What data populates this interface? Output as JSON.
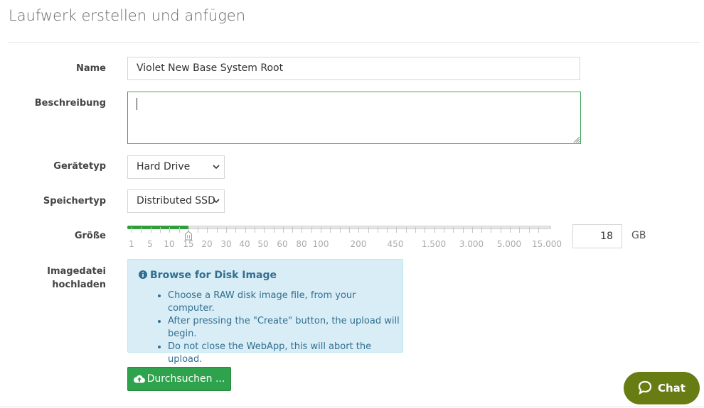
{
  "page": {
    "title": "Laufwerk erstellen und anfügen"
  },
  "form": {
    "name": {
      "label": "Name",
      "value": "Violet New Base System Root"
    },
    "description": {
      "label": "Beschreibung",
      "value": ""
    },
    "device_type": {
      "label": "Gerätetyp",
      "value": "Hard Drive"
    },
    "storage_type": {
      "label": "Speichertyp",
      "value": "Distributed SSD"
    },
    "size": {
      "label": "Größe",
      "value": "18",
      "unit": "GB",
      "ticks": [
        "1",
        "5",
        "10",
        "15",
        "20",
        "30",
        "40",
        "50",
        "60",
        "80",
        "100",
        "200",
        "450",
        "1.500",
        "3.000",
        "5.000",
        "15.000"
      ],
      "handle_at_tick": "15"
    },
    "image_upload": {
      "label_line1": "Imagedatei",
      "label_line2": "hochladen",
      "info_title": "Browse for Disk Image",
      "info_items": [
        "Choose a RAW disk image file, from your computer.",
        "After pressing the \"Create\" button, the upload will begin.",
        "Do not close the WebApp, this will abort the upload."
      ],
      "browse_label": "Durchsuchen ..."
    }
  },
  "chat": {
    "label": "Chat"
  },
  "colors": {
    "accent_green": "#2ea24c",
    "info_bg": "#d9edf7",
    "info_text": "#31708f",
    "chat_bg": "#677d14"
  },
  "icons": {
    "info": "info-circle-icon",
    "upload": "cloud-upload-icon",
    "chat": "chat-bubble-icon",
    "dropdown": "chevron-down-icon"
  }
}
